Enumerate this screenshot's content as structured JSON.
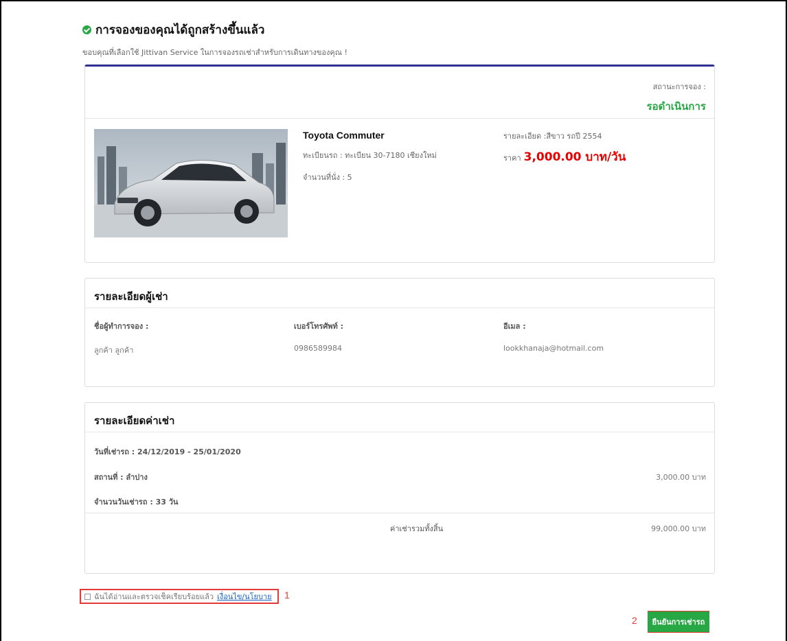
{
  "header": {
    "title": "การจองของคุณได้ถูกสร้างขึ้นแล้ว",
    "subtitle": "ขอบคุณที่เลือกใช้ Jittivan Service ในการจองรถเช่าสำหรับการเดินทางของคุณ !"
  },
  "booking": {
    "status_label": "สถานะการจอง :",
    "status_value": "รอดำเนินการ",
    "car_name": "Toyota Commuter",
    "plate": "ทะเบียนรถ : ทะเบียน 30-7180 เชียงใหม่",
    "seats": "จำนวนที่นั่ง : 5",
    "detail": "รายละเอียด :สีขาว รถปี 2554",
    "price_label": "ราคา",
    "price": "3,000.00 บาท/วัน",
    "colors": {
      "accent": "#2e3192",
      "status": "#28a745",
      "price": "#e60000"
    }
  },
  "renter": {
    "title": "รายละเอียดผู้เช่า",
    "name_label": "ชื่อผู้ทำการจอง :",
    "name_value": "ลูกค้า ลูกค้า",
    "phone_label": "เบอร์โทรศัพท์ :",
    "phone_value": "0986589984",
    "email_label": "อีเมล :",
    "email_value": "lookkhanaja@hotmail.com"
  },
  "cost": {
    "title": "รายละเอียดค่าเช่า",
    "dates": "วันที่เช่ารถ : 24/12/2019 - 25/01/2020",
    "location": "สถานที่ : ลำปาง",
    "location_amount": "3,000.00 บาท",
    "days": "จำนวนวันเช่ารถ : 33 วัน",
    "total_label": "ค่าเช่ารวมทั้งสิ้น",
    "total_amount": "99,000.00 บาท"
  },
  "agreement": {
    "text": "ฉันได้อ่านและตรวจเช็คเรียบร้อยแล้ว",
    "link": "เงื่อนไข/นโยบาย",
    "marker": "1"
  },
  "confirm": {
    "label": "ยืนยันการเช่ารถ",
    "marker": "2"
  }
}
